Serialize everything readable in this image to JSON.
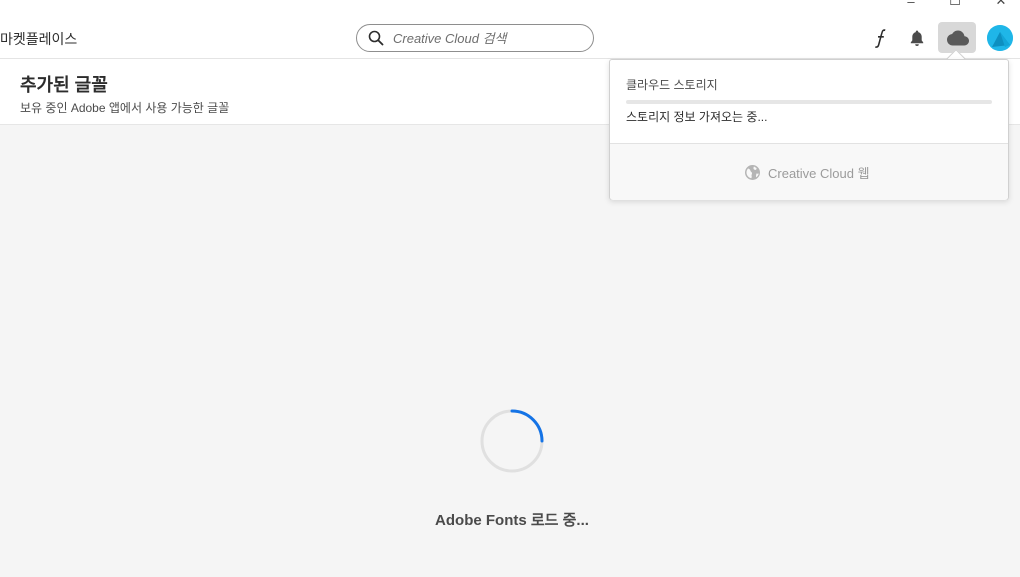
{
  "window_controls": {
    "minimize": "–",
    "maximize": "☐",
    "close": "✕"
  },
  "nav": {
    "label": "마켓플레이스"
  },
  "search": {
    "placeholder": "Creative Cloud 검색"
  },
  "toolbar": {
    "fonts_icon": "font-f-icon",
    "bell_icon": "bell-icon",
    "cloud_icon": "cloud-icon",
    "avatar_color": "#1fb6e8"
  },
  "header": {
    "title": "추가된 글꼴",
    "subtitle": "보유 중인 Adobe 앱에서 사용 가능한 글꼴"
  },
  "popover": {
    "title": "클라우드 스토리지",
    "storage_fraction": 0.0,
    "status": "스토리지 정보 가져오는 중...",
    "web_link": "Creative Cloud 웹"
  },
  "loading": {
    "text": "Adobe Fonts 로드 중..."
  },
  "colors": {
    "accent": "#1473e6",
    "spinner_track": "#e0e0e0"
  }
}
